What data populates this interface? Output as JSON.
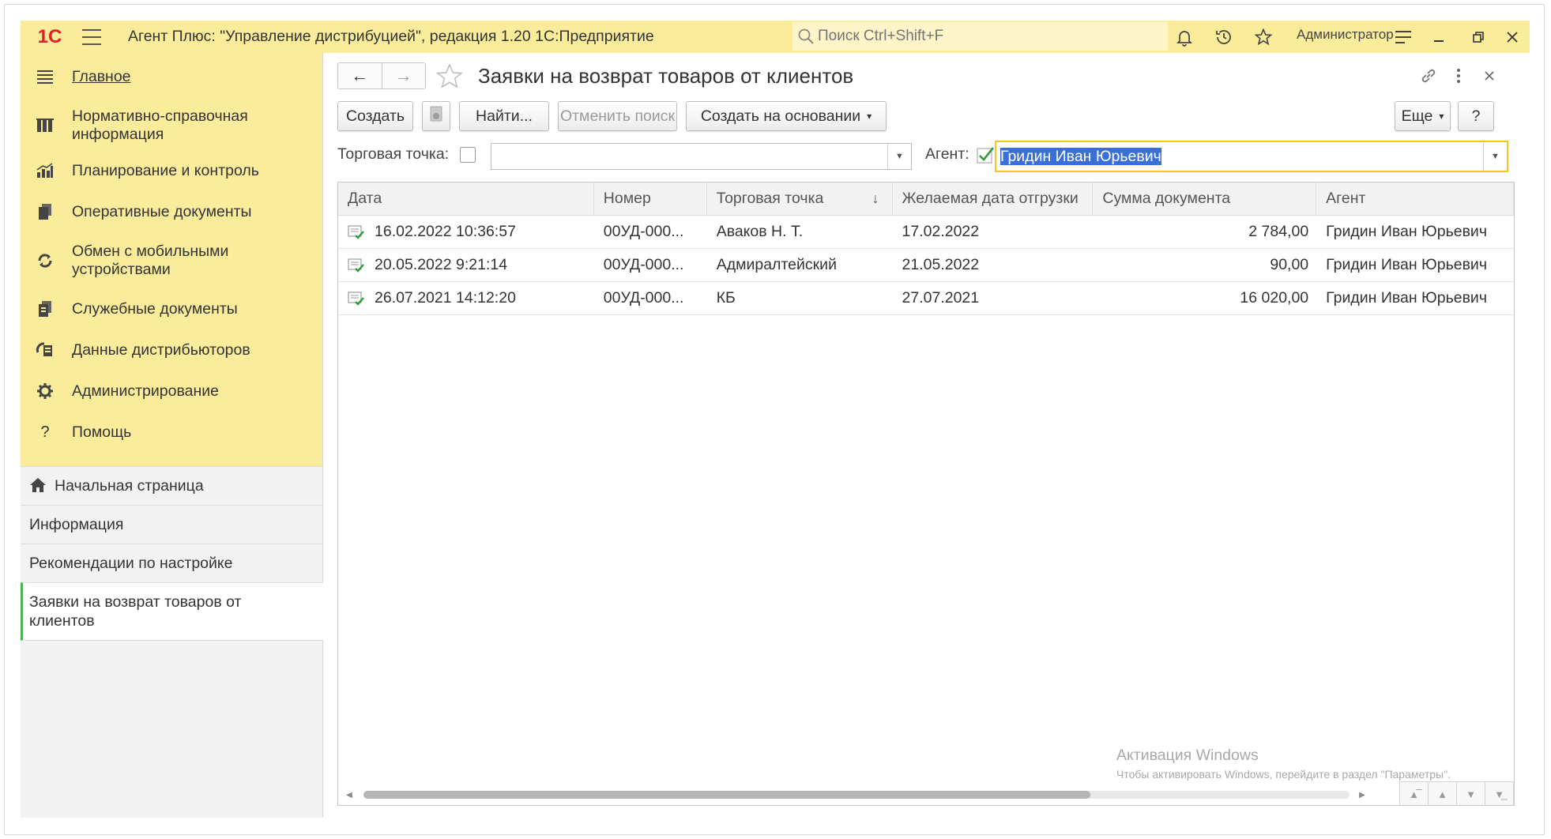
{
  "app": {
    "logo_text": "1С",
    "title": "Агент Плюс: \"Управление дистрибуцией\", редакция 1.20 1С:Предприятие",
    "search_placeholder": "Поиск Ctrl+Shift+F",
    "user": "Администратор",
    "accent_color": "#fbec9c"
  },
  "sidebar": {
    "sections": [
      {
        "label": "Главное",
        "icon": "menu-icon"
      },
      {
        "label": "Нормативно-справочная информация",
        "icon": "catalog-icon"
      },
      {
        "label": "Планирование и контроль",
        "icon": "chart-icon"
      },
      {
        "label": "Оперативные документы",
        "icon": "documents-icon"
      },
      {
        "label": "Обмен с мобильными устройствами",
        "icon": "sync-icon"
      },
      {
        "label": "Служебные документы",
        "icon": "service-docs-icon"
      },
      {
        "label": "Данные дистрибьюторов",
        "icon": "distributor-icon"
      },
      {
        "label": "Администрирование",
        "icon": "gear-icon"
      },
      {
        "label": "Помощь",
        "icon": "help-icon"
      }
    ],
    "open_windows": {
      "home": "Начальная страница",
      "info": "Информация",
      "recommendations": "Рекомендации по настройке",
      "current": "Заявки на возврат товаров от клиентов"
    }
  },
  "form": {
    "title": "Заявки на возврат товаров от клиентов",
    "toolbar": {
      "create": "Создать",
      "find": "Найти...",
      "cancel_search": "Отменить поиск",
      "create_based_on": "Создать на основании",
      "more": "Еще",
      "help": "?"
    },
    "filters": {
      "outlet_label": "Торговая точка:",
      "outlet_checked": false,
      "outlet_value": "",
      "agent_label": "Агент:",
      "agent_checked": true,
      "agent_value": "Гридин Иван Юрьевич"
    },
    "table": {
      "columns": [
        "Дата",
        "Номер",
        "Торговая точка",
        "Желаемая дата отгрузки",
        "Сумма документа",
        "Агент"
      ],
      "sort_column": "Торговая точка",
      "sort_icon": "↓",
      "rows": [
        [
          "16.02.2022 10:36:57",
          "00УД-000...",
          "Аваков Н. Т.",
          "17.02.2022",
          "2 784,00",
          "Гридин Иван Юрьевич"
        ],
        [
          "20.05.2022 9:21:14",
          "00УД-000...",
          "Адмиралтейский",
          "21.05.2022",
          "90,00",
          "Гридин Иван Юрьевич"
        ],
        [
          "26.07.2021 14:12:20",
          "00УД-000...",
          "КБ",
          "27.07.2021",
          "16 020,00",
          "Гридин Иван Юрьевич"
        ]
      ]
    }
  },
  "watermark": {
    "line1": "Активация Windows",
    "line2": "Чтобы активировать Windows, перейдите в раздел \"Параметры\"."
  }
}
